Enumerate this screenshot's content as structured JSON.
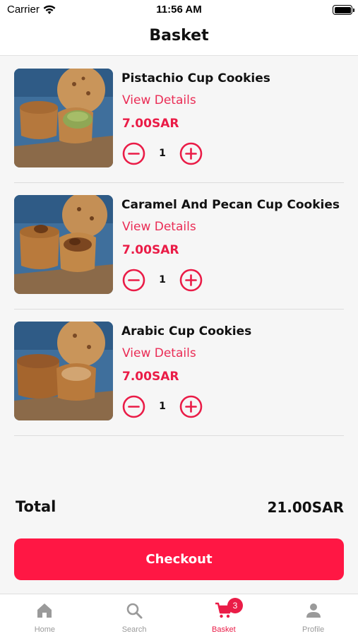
{
  "status_bar": {
    "carrier": "Carrier",
    "time": "11:56 AM"
  },
  "nav": {
    "title": "Basket"
  },
  "basket": {
    "items": [
      {
        "name": "Pistachio Cup Cookies",
        "details_label": "View Details",
        "price": "7.00SAR",
        "quantity": "1",
        "image_icon": "pistachio-cup-cookie-photo"
      },
      {
        "name": "Caramel And Pecan Cup Cookies",
        "details_label": "View Details",
        "price": "7.00SAR",
        "quantity": "1",
        "image_icon": "caramel-pecan-cup-cookie-photo"
      },
      {
        "name": "Arabic Cup Cookies",
        "details_label": "View Details",
        "price": "7.00SAR",
        "quantity": "1",
        "image_icon": "arabic-cup-cookie-photo"
      }
    ]
  },
  "summary": {
    "total_label": "Total",
    "total_value": "21.00SAR"
  },
  "checkout": {
    "label": "Checkout"
  },
  "tabs": [
    {
      "label": "Home",
      "icon": "home-icon",
      "active": false
    },
    {
      "label": "Search",
      "icon": "search-icon",
      "active": false
    },
    {
      "label": "Basket",
      "icon": "cart-icon",
      "active": true,
      "badge": "3"
    },
    {
      "label": "Profile",
      "icon": "person-icon",
      "active": false
    }
  ],
  "colors": {
    "accent": "#ff1744",
    "price": "#ea1c47",
    "link": "#ea2c55",
    "inactive_tab": "#9a9a9a"
  }
}
